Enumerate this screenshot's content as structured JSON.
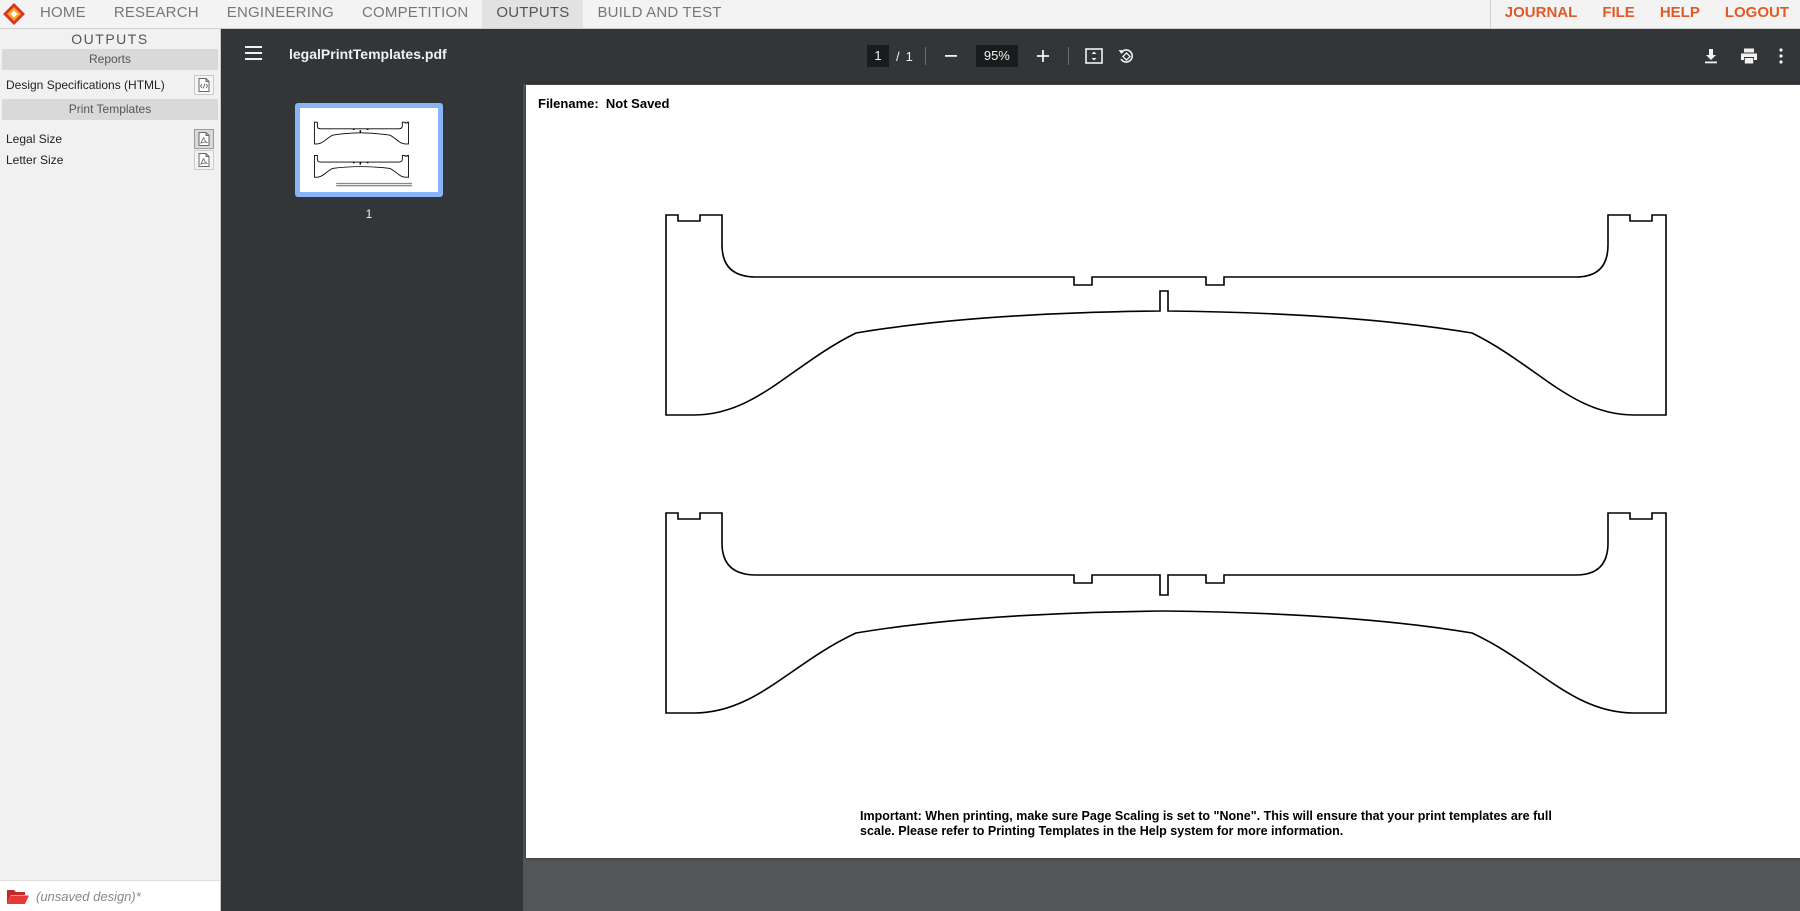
{
  "nav": {
    "left": [
      "HOME",
      "RESEARCH",
      "ENGINEERING",
      "COMPETITION",
      "OUTPUTS",
      "BUILD AND TEST"
    ],
    "active": "OUTPUTS",
    "right": [
      "JOURNAL",
      "FILE",
      "HELP",
      "LOGOUT"
    ],
    "accent": "#e05a28"
  },
  "left_panel": {
    "title": "OUTPUTS",
    "reports_header": "Reports",
    "reports": [
      {
        "label": "Design Specifications (HTML)",
        "icon": "html-file-icon"
      }
    ],
    "templates_header": "Print Templates",
    "templates": [
      {
        "label": "Legal Size",
        "icon": "pdf-file-icon",
        "selected": true
      },
      {
        "label": "Letter Size",
        "icon": "pdf-file-icon",
        "selected": false
      }
    ],
    "footer_filename": "(unsaved design)*"
  },
  "viewer": {
    "filename": "legalPrintTemplates.pdf",
    "page_current": "1",
    "page_separator": "/",
    "page_total": "1",
    "zoom": "95%",
    "thumbnail_label": "1"
  },
  "document": {
    "filename_line": "Filename:  Not Saved",
    "note": "Important:  When printing, make sure Page Scaling is set to \"None\".  This will ensure that your print templates are full scale.  Please refer to Printing Templates in the Help system for more information."
  }
}
